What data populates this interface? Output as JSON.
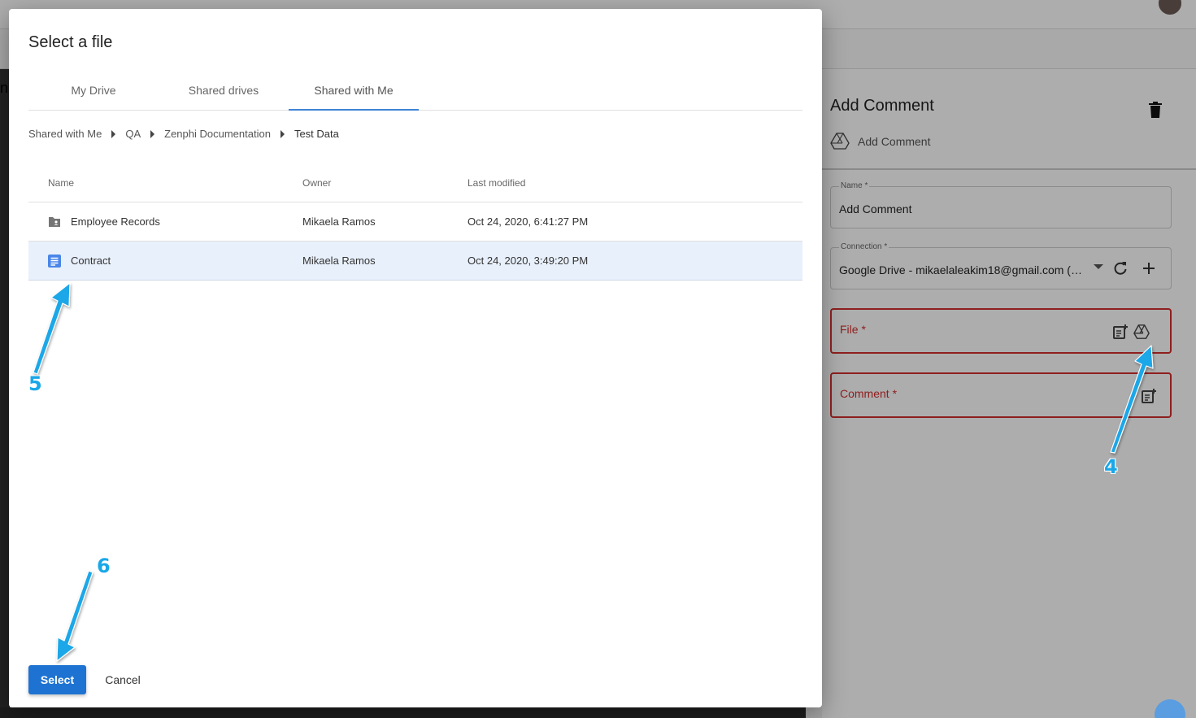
{
  "dialog": {
    "title": "Select a file",
    "tabs": [
      {
        "label": "My Drive"
      },
      {
        "label": "Shared drives"
      },
      {
        "label": "Shared with Me",
        "active": true
      }
    ],
    "breadcrumb": [
      "Shared with Me",
      "QA",
      "Zenphi Documentation",
      "Test Data"
    ],
    "columns": {
      "name": "Name",
      "owner": "Owner",
      "modified": "Last modified"
    },
    "rows": [
      {
        "name": "Employee Records",
        "icon": "shared-folder-icon",
        "owner": "Mikaela Ramos",
        "modified": "Oct 24, 2020, 6:41:27 PM",
        "selected": false
      },
      {
        "name": "Contract",
        "icon": "google-doc-icon",
        "owner": "Mikaela Ramos",
        "modified": "Oct 24, 2020, 3:49:20 PM",
        "selected": true
      }
    ],
    "select_label": "Select",
    "cancel_label": "Cancel"
  },
  "panel": {
    "title": "Add Comment",
    "subtitle": "Add Comment",
    "name_field": {
      "label": "Name *",
      "value": "Add Comment"
    },
    "connection_field": {
      "label": "Connection *",
      "value": "Google Drive - mikaelaleakim18@gmail.com (mi..."
    },
    "file_field": {
      "placeholder": "File *"
    },
    "comment_field": {
      "placeholder": "Comment *"
    }
  },
  "background": {
    "left_fragment": "n"
  },
  "annotations": [
    {
      "number": "4"
    },
    {
      "number": "5"
    },
    {
      "number": "6"
    }
  ],
  "colors": {
    "accent": "#1e73d2",
    "error": "#d32f2f",
    "annotation": "#1aa7e8",
    "selected_row": "#e8f0fb"
  }
}
